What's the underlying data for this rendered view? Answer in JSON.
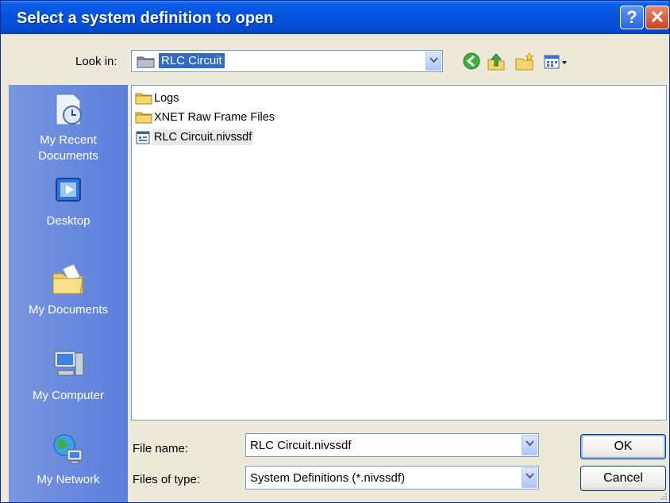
{
  "window": {
    "title": "Select a system definition to open",
    "help_glyph": "?",
    "close_glyph": "✕"
  },
  "lookin": {
    "label": "Look in:",
    "value": "RLC Circuit"
  },
  "toolbar": {
    "icons": [
      "back-icon",
      "up-folder-icon",
      "new-folder-icon",
      "view-menu-icon"
    ]
  },
  "places": [
    {
      "label": "My Recent\nDocuments",
      "icon": "recent-documents-icon"
    },
    {
      "label": "Desktop",
      "icon": "desktop-icon"
    },
    {
      "label": "My Documents",
      "icon": "my-documents-icon"
    },
    {
      "label": "My Computer",
      "icon": "my-computer-icon"
    },
    {
      "label": "My Network",
      "icon": "my-network-icon"
    }
  ],
  "files": [
    {
      "name": "Logs",
      "type": "folder"
    },
    {
      "name": "XNET Raw Frame Files",
      "type": "folder"
    },
    {
      "name": "RLC Circuit.nivssdf",
      "type": "file",
      "selected": true
    }
  ],
  "filename": {
    "label": "File name:",
    "value": "RLC Circuit.nivssdf"
  },
  "filetype": {
    "label": "Files of type:",
    "value": "System Definitions (*.nivssdf)"
  },
  "buttons": {
    "ok": "OK",
    "cancel": "Cancel"
  }
}
